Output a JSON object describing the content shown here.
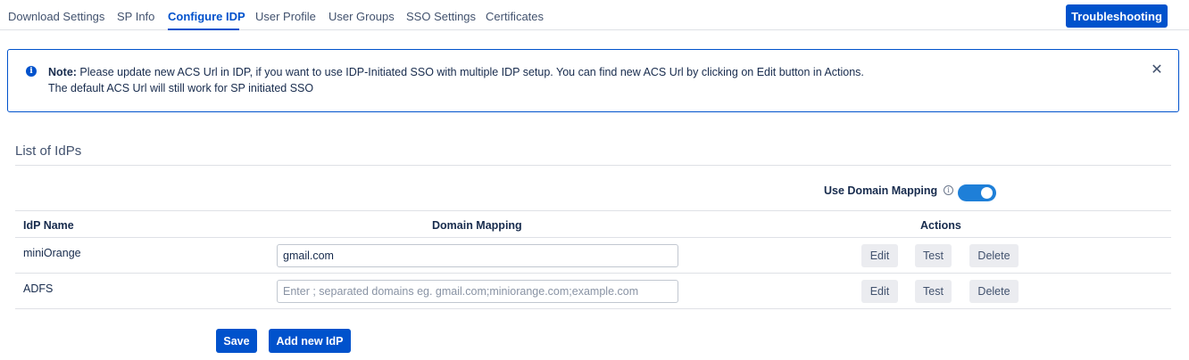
{
  "tabs": [
    {
      "label": "Download Settings",
      "active": false
    },
    {
      "label": "SP Info",
      "active": false
    },
    {
      "label": "Configure IDP",
      "active": true
    },
    {
      "label": "User Profile",
      "active": false
    },
    {
      "label": "User Groups",
      "active": false
    },
    {
      "label": "SSO Settings",
      "active": false
    },
    {
      "label": "Certificates",
      "active": false
    }
  ],
  "troubleshooting_label": "Troubleshooting",
  "notice": {
    "icon": "info-icon",
    "note_label": "Note:",
    "line1": " Please update new ACS Url in IDP, if you want to use IDP-Initiated SSO with multiple IDP setup. You can find new ACS Url by clicking on Edit button in Actions.",
    "line2": "The default ACS Url will still work for SP initiated SSO",
    "close_glyph": "✕"
  },
  "section_title": "List of IdPs",
  "domain_mapping_toggle": {
    "label": "Use Domain Mapping",
    "info_glyph": "i",
    "enabled": true
  },
  "table": {
    "headers": {
      "name": "IdP Name",
      "domain": "Domain Mapping",
      "actions": "Actions"
    },
    "rows": [
      {
        "name": "miniOrange",
        "domain_value": "gmail.com",
        "placeholder": ""
      },
      {
        "name": "ADFS",
        "domain_value": "",
        "placeholder": "Enter ; separated domains eg. gmail.com;miniorange.com;example.com"
      }
    ],
    "action_labels": {
      "edit": "Edit",
      "test": "Test",
      "delete": "Delete"
    }
  },
  "footer": {
    "save_label": "Save",
    "add_label": "Add new IdP"
  },
  "colors": {
    "accent": "#0052cc",
    "toggle_on": "#1e7fd8",
    "secondary_button": "#ebecf0"
  }
}
